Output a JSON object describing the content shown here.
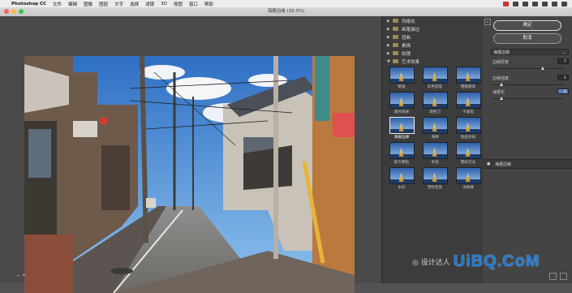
{
  "menubar": {
    "apple": "",
    "app": "Photoshop CC",
    "items": [
      "文件",
      "编辑",
      "图像",
      "图层",
      "文字",
      "选择",
      "滤镜",
      "3D",
      "视图",
      "窗口",
      "帮助"
    ]
  },
  "dialog": {
    "title": "海报边缘 (33.3%)"
  },
  "gallery": {
    "categories": [
      "风格化",
      "画笔描边",
      "扭曲",
      "素描",
      "纹理",
      "艺术效果"
    ],
    "thumbnails": [
      "壁画",
      "彩色铅笔",
      "粗糙蜡笔",
      "底纹效果",
      "调色刀",
      "干画笔",
      "海报边缘",
      "海绵",
      "绘画涂抹",
      "胶片颗粒",
      "木刻",
      "霓虹灯光",
      "水彩",
      "塑料包装",
      "涂抹棒"
    ],
    "selected_index": 6
  },
  "controls": {
    "ok_label": "确定",
    "cancel_label": "取消",
    "filter_select": "海报边缘",
    "params": [
      {
        "label": "边缘厚度",
        "value": "7",
        "level": 0.7
      },
      {
        "label": "边缘强度",
        "value": "1",
        "level": 0.1
      },
      {
        "label": "海报化",
        "value": "1",
        "level": 0.1
      }
    ],
    "layer_name": "海报边缘"
  },
  "watermark": {
    "text": "UiBQ.CoM",
    "badge": "◎ 设计达人"
  },
  "colors": {
    "close": "#fc605c",
    "minimize": "#fdbc40",
    "zoom": "#34c84a",
    "selected_value": "#5a7fc0"
  }
}
